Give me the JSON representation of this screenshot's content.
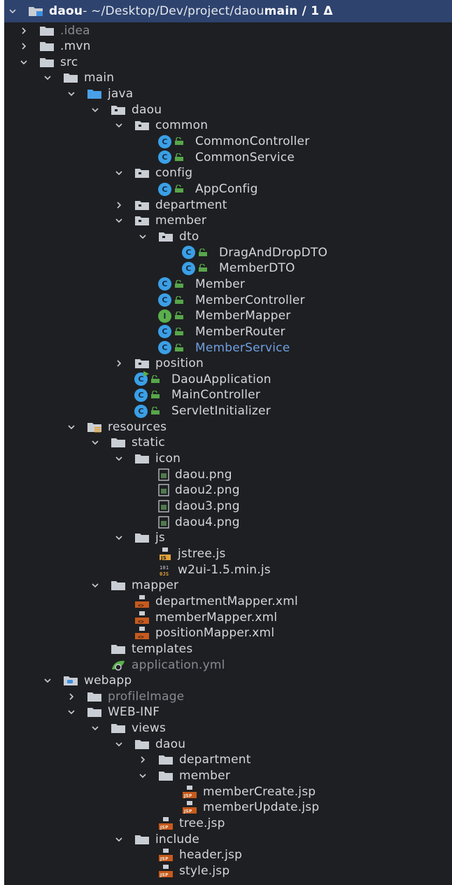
{
  "header": {
    "project": "daou",
    "path": " - ~/Desktop/Dev/project/daou ",
    "vcs": "main / 1 Δ"
  },
  "colors": {
    "panel_bg": "#1e1f22",
    "header_bg": "#2e436e",
    "text": "#d4d6db",
    "dim_text": "#868a91",
    "selected_text": "#6f9fe0",
    "class_badge": "#3aa0e6",
    "interface_badge": "#5ab04b",
    "access_icon": "#57a64a",
    "xml_icon": "#c75a1c",
    "jsp_icon": "#c75a1c"
  },
  "tree": [
    {
      "label": ".idea",
      "depth": 1,
      "chevron": "right",
      "icon": "folder-icon",
      "style": "dim"
    },
    {
      "label": ".mvn",
      "depth": 1,
      "chevron": "right",
      "icon": "folder-icon"
    },
    {
      "label": "src",
      "depth": 1,
      "chevron": "down",
      "icon": "folder-icon"
    },
    {
      "label": "main",
      "depth": 2,
      "chevron": "down",
      "icon": "folder-icon"
    },
    {
      "label": "java",
      "depth": 3,
      "chevron": "down",
      "icon": "source-folder-icon"
    },
    {
      "label": "daou",
      "depth": 4,
      "chevron": "down",
      "icon": "package-icon"
    },
    {
      "label": "common",
      "depth": 5,
      "chevron": "down",
      "icon": "package-icon"
    },
    {
      "label": "CommonController",
      "depth": 6,
      "icon": "class-icon"
    },
    {
      "label": "CommonService",
      "depth": 6,
      "icon": "class-icon"
    },
    {
      "label": "config",
      "depth": 5,
      "chevron": "down",
      "icon": "package-icon"
    },
    {
      "label": "AppConfig",
      "depth": 6,
      "icon": "class-icon"
    },
    {
      "label": "department",
      "depth": 5,
      "chevron": "right",
      "icon": "package-icon"
    },
    {
      "label": "member",
      "depth": 5,
      "chevron": "down",
      "icon": "package-icon"
    },
    {
      "label": "dto",
      "depth": 6,
      "chevron": "down",
      "icon": "package-icon"
    },
    {
      "label": "DragAndDropDTO",
      "depth": 7,
      "icon": "class-icon"
    },
    {
      "label": "MemberDTO",
      "depth": 7,
      "icon": "class-icon"
    },
    {
      "label": "Member",
      "depth": 6,
      "icon": "class-icon"
    },
    {
      "label": "MemberController",
      "depth": 6,
      "icon": "class-icon"
    },
    {
      "label": "MemberMapper",
      "depth": 6,
      "icon": "interface-icon"
    },
    {
      "label": "MemberRouter",
      "depth": 6,
      "icon": "class-icon"
    },
    {
      "label": "MemberService",
      "depth": 6,
      "icon": "class-icon",
      "style": "blue"
    },
    {
      "label": "position",
      "depth": 5,
      "chevron": "right",
      "icon": "package-icon"
    },
    {
      "label": "DaouApplication",
      "depth": 5,
      "icon": "spring-boot-class-icon"
    },
    {
      "label": "MainController",
      "depth": 5,
      "icon": "class-icon"
    },
    {
      "label": "ServletInitializer",
      "depth": 5,
      "icon": "class-icon"
    },
    {
      "label": "resources",
      "depth": 3,
      "chevron": "down",
      "icon": "resources-folder-icon"
    },
    {
      "label": "static",
      "depth": 4,
      "chevron": "down",
      "icon": "folder-icon"
    },
    {
      "label": "icon",
      "depth": 5,
      "chevron": "down",
      "icon": "folder-icon"
    },
    {
      "label": "daou.png",
      "depth": 6,
      "icon": "image-file-icon"
    },
    {
      "label": "daou2.png",
      "depth": 6,
      "icon": "image-file-icon"
    },
    {
      "label": "daou3.png",
      "depth": 6,
      "icon": "image-file-icon"
    },
    {
      "label": "daou4.png",
      "depth": 6,
      "icon": "image-file-icon"
    },
    {
      "label": "js",
      "depth": 5,
      "chevron": "down",
      "icon": "folder-icon"
    },
    {
      "label": "jstree.js",
      "depth": 6,
      "icon": "js-file-icon"
    },
    {
      "label": "w2ui-1.5.min.js",
      "depth": 6,
      "icon": "minified-js-file-icon"
    },
    {
      "label": "mapper",
      "depth": 4,
      "chevron": "down",
      "icon": "folder-icon"
    },
    {
      "label": "departmentMapper.xml",
      "depth": 5,
      "icon": "xml-file-icon"
    },
    {
      "label": "memberMapper.xml",
      "depth": 5,
      "icon": "xml-file-icon"
    },
    {
      "label": "positionMapper.xml",
      "depth": 5,
      "icon": "xml-file-icon"
    },
    {
      "label": "templates",
      "depth": 4,
      "icon": "folder-icon"
    },
    {
      "label": "application.yml",
      "depth": 4,
      "icon": "spring-yml-icon",
      "style": "dim"
    },
    {
      "label": "webapp",
      "depth": 2,
      "chevron": "down",
      "icon": "web-folder-icon"
    },
    {
      "label": "profileImage",
      "depth": 3,
      "chevron": "right",
      "icon": "folder-icon",
      "style": "dim"
    },
    {
      "label": "WEB-INF",
      "depth": 3,
      "chevron": "down",
      "icon": "folder-icon"
    },
    {
      "label": "views",
      "depth": 4,
      "chevron": "down",
      "icon": "folder-icon"
    },
    {
      "label": "daou",
      "depth": 5,
      "chevron": "down",
      "icon": "folder-icon"
    },
    {
      "label": "department",
      "depth": 6,
      "chevron": "right",
      "icon": "folder-icon"
    },
    {
      "label": "member",
      "depth": 6,
      "chevron": "down",
      "icon": "folder-icon"
    },
    {
      "label": "memberCreate.jsp",
      "depth": 7,
      "icon": "jsp-file-icon"
    },
    {
      "label": "memberUpdate.jsp",
      "depth": 7,
      "icon": "jsp-file-icon"
    },
    {
      "label": "tree.jsp",
      "depth": 6,
      "icon": "jsp-file-icon"
    },
    {
      "label": "include",
      "depth": 5,
      "chevron": "down",
      "icon": "folder-icon"
    },
    {
      "label": "header.jsp",
      "depth": 6,
      "icon": "jsp-file-icon"
    },
    {
      "label": "style.jsp",
      "depth": 6,
      "icon": "jsp-file-icon"
    }
  ]
}
